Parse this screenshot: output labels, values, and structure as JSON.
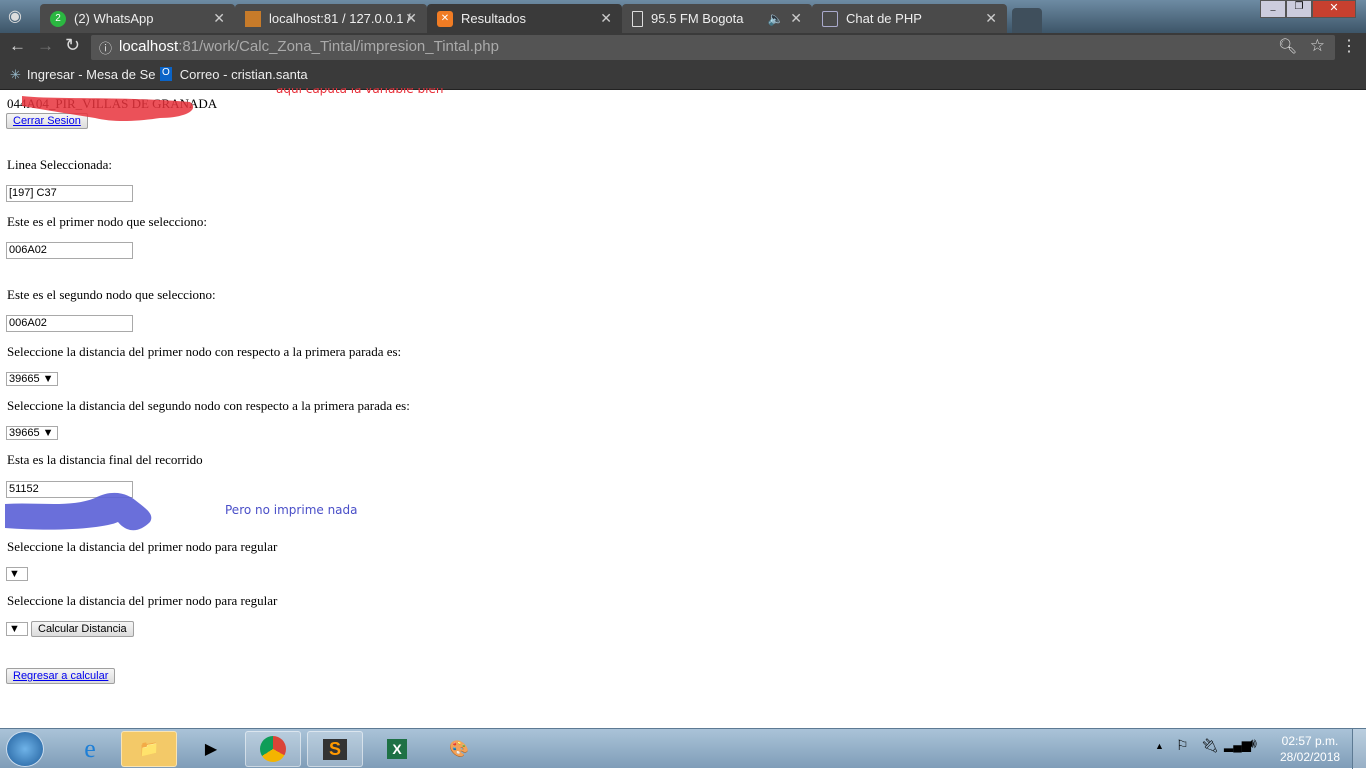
{
  "browser": {
    "tabs": [
      {
        "label": "(2) WhatsApp",
        "icon": "whatsapp-icon",
        "badge": "2"
      },
      {
        "label": "localhost:81 / 127.0.0.1 /",
        "icon": "phpmyadmin-icon"
      },
      {
        "label": "Resultados",
        "icon": "xampp-icon",
        "active": true
      },
      {
        "label": "95.5 FM Bogota",
        "icon": "document-icon"
      },
      {
        "label": "Chat de PHP",
        "icon": "chat-icon"
      }
    ],
    "url_host": "localhost",
    "url_rest": ":81/work/Calc_Zona_Tintal/impresion_Tintal.php",
    "bookmarks": [
      {
        "label": "Ingresar - Mesa de Se"
      },
      {
        "label": "Correo - cristian.santa"
      }
    ]
  },
  "annotations": {
    "red_note": "aqui caputa la variable bien",
    "blue_note": "Pero no imprime nada",
    "red_color": "#e8323c",
    "blue_color": "#5a5fd6"
  },
  "page": {
    "header_text": "044A04_PIR_VILLAS DE GRANADA",
    "logout_label": "Cerrar Sesion",
    "linea_label": "Linea Seleccionada:",
    "linea_value": "[197] C37",
    "nodo1_label": "Este es el primer nodo que selecciono:",
    "nodo1_value": "006A02",
    "nodo2_label": "Este es el segundo nodo que selecciono:",
    "nodo2_value": "006A02",
    "dist1_label": "Seleccione la distancia del primer nodo con respecto a la primera parada es:",
    "dist1_value": "39665",
    "dist2_label": "Seleccione la distancia del segundo nodo con respecto a la primera parada es:",
    "dist2_value": "39665",
    "final_label": "Esta es la distancia final del recorrido",
    "final_value": "51152",
    "reg1_label": "Seleccione la distancia del primer nodo para regular",
    "reg1_value": "",
    "reg2_label": "Seleccione la distancia del primer nodo para regular",
    "reg2_value": "",
    "calc_label": "Calcular Distancia",
    "back_label": "Regresar a calcular"
  },
  "taskbar": {
    "time": "02:57 p.m.",
    "date": "28/02/2018"
  }
}
